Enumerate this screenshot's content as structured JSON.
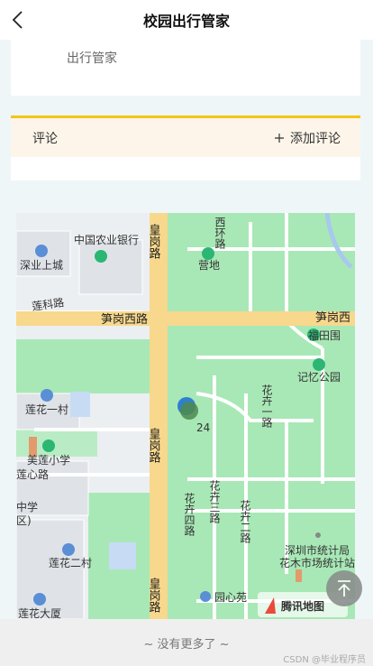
{
  "header": {
    "title": "校园出行管家"
  },
  "info": {
    "description": "出行管家"
  },
  "comments": {
    "label": "评论",
    "add_label": "添加评论"
  },
  "map": {
    "logo_text": "腾讯地图",
    "labels": {
      "bank": "中国农业银行",
      "shenye": "深业上城",
      "lianke": "莲科路",
      "sungang_w": "笋岗西路",
      "sungang_e": "笋岗西",
      "huanggang_n": "皇岗路",
      "huanggang_s": "皇岗路",
      "huanggang_bottom": "皇岗路",
      "xihuan": "西环路",
      "yingdi": "营地",
      "futian": "福田围",
      "jiyi": "记忆公园",
      "lianhua1": "莲花一村",
      "meilian": "美莲小学",
      "lianxin": "莲心路",
      "zhongxue": "中学",
      "qu": "区)",
      "lianhua2": "莲花二村",
      "lianhua_dasha": "莲花大厦",
      "huahui1": "花卉一路",
      "huahui2": "花卉二路",
      "huahui3": "花卉三路",
      "huahui4": "花卉四路",
      "tongji1": "深圳市统计局",
      "tongji2": "花木市场统计站",
      "yuanxin": "园心苑",
      "marker_num": "24"
    }
  },
  "footer": {
    "text": "~ 没有更多了 ~",
    "watermark": "CSDN @毕业程序员"
  },
  "colors": {
    "accent": "#f5c518",
    "road": "#f7d88c",
    "park": "#a8e8b6",
    "block": "#dfe3e8"
  }
}
